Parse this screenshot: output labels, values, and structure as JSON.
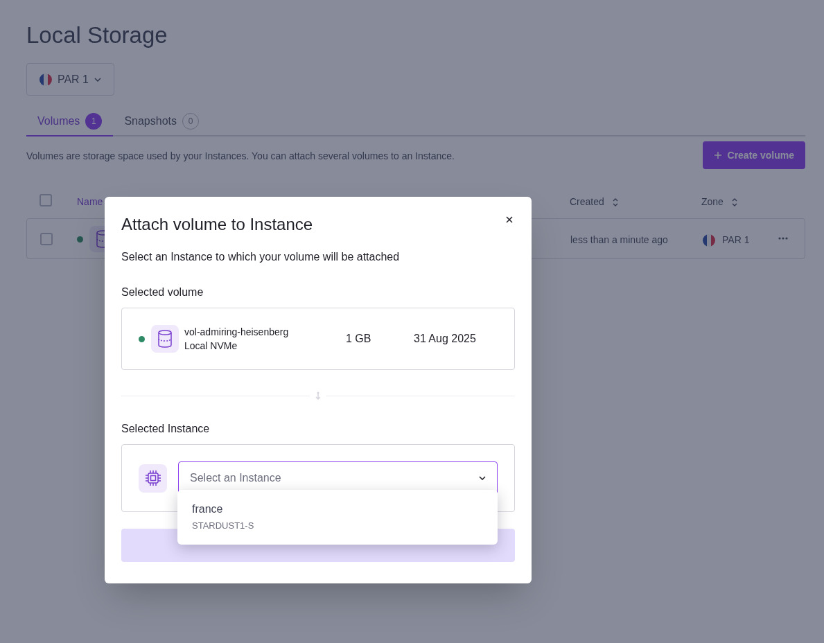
{
  "page": {
    "title": "Local Storage",
    "zone_selector": {
      "label": "PAR 1"
    },
    "tabs": [
      {
        "label": "Volumes",
        "count": "1",
        "selected": true
      },
      {
        "label": "Snapshots",
        "count": "0",
        "selected": false
      }
    ],
    "description": "Volumes are storage space used by your Instances. You can attach several volumes to an Instance.",
    "create_button": "Create volume"
  },
  "table": {
    "header_checked": false,
    "columns": [
      "Name",
      "Created",
      "Zone"
    ],
    "rows": [
      {
        "checked": false,
        "color": "#26554f",
        "created": "less than a minute ago",
        "zone": "PAR 1"
      }
    ]
  },
  "modal": {
    "title": "Attach volume to Instance",
    "subtitle": "Select an Instance to which your volume will be attached",
    "volume_label": "Selected volume",
    "volume": {
      "color": "#2e8a64",
      "name": "vol-admiring-heisenberg",
      "type": "Local NVMe",
      "size": "1 GB",
      "date": "31 Aug 2025"
    },
    "instance_label": "Selected Instance",
    "instance_select": {
      "placeholder": "Select an Instance",
      "expanded": true,
      "options": [
        {
          "name": "france",
          "type": "STARDUST1-S"
        }
      ]
    }
  }
}
